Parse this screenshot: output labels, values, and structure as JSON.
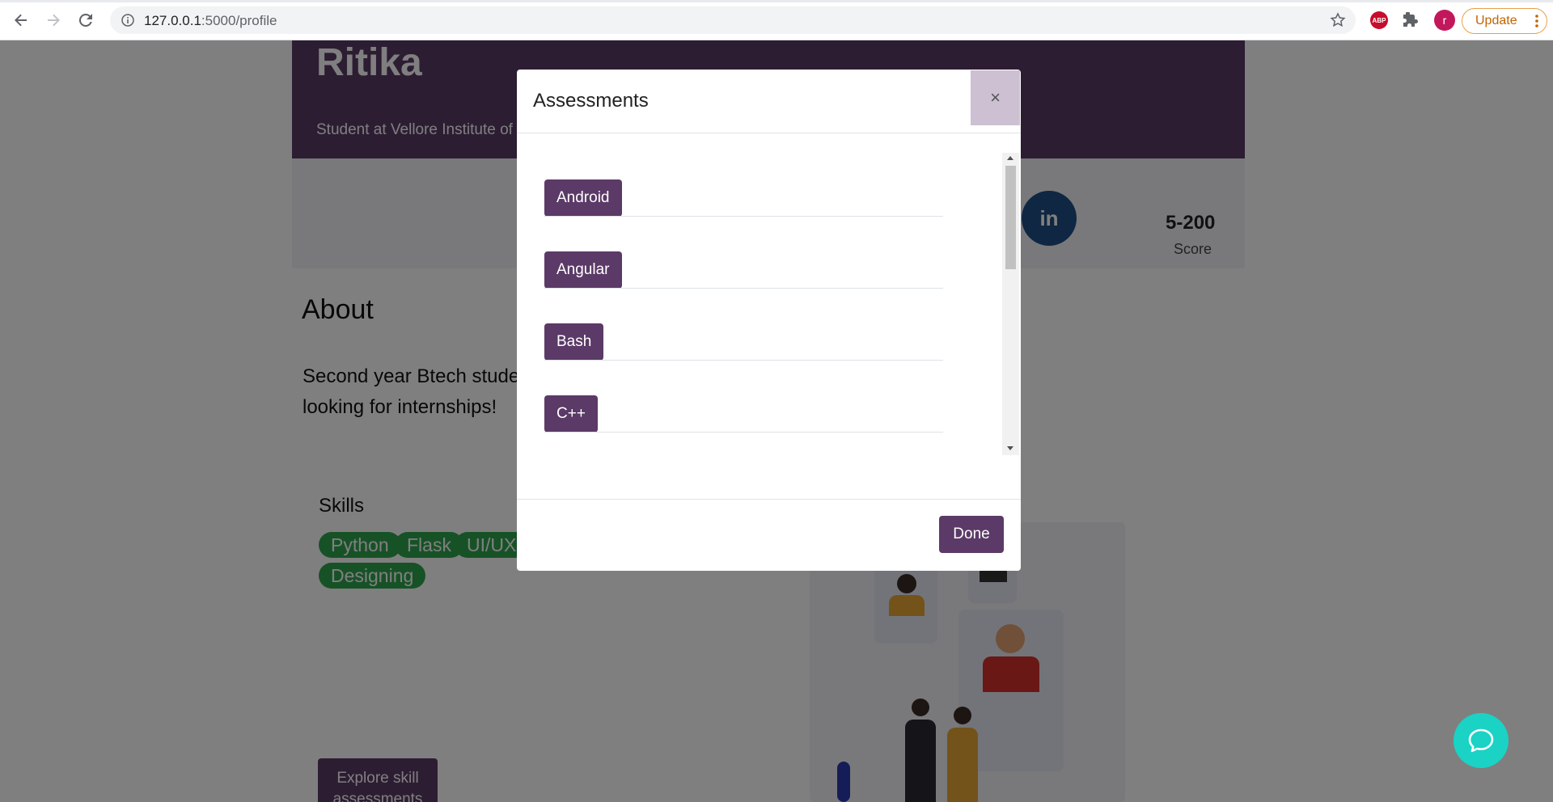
{
  "browser": {
    "url_host": "127.0.0.1",
    "url_port_path": ":5000/profile",
    "abp_label": "ABP",
    "avatar_letter": "r",
    "update_label": "Update"
  },
  "profile": {
    "name": "Ritika",
    "subtitle": "Student at Vellore Institute of Technology",
    "score_value": "5-200",
    "score_label": "Score",
    "linkedin_label": "in",
    "about_heading": "About",
    "about_text": "Second year Btech student looking for internships!",
    "skills_heading": "Skills",
    "skills": [
      "Python",
      "Flask",
      "UI/UX",
      "Designing"
    ],
    "explore_label": "Explore skill assessments"
  },
  "modal": {
    "title": "Assessments",
    "close_symbol": "×",
    "assessments": [
      "Android",
      "Angular",
      "Bash",
      "C++"
    ],
    "done_label": "Done"
  },
  "colors": {
    "primary": "#5b3a67",
    "skill_chip": "#2ea44f",
    "chat_bubble": "#1ad3c5",
    "linkedin": "#1f4f84"
  },
  "icons": {
    "back": "arrow-left-icon",
    "forward": "arrow-right-icon",
    "reload": "reload-icon",
    "info": "info-icon",
    "star": "star-icon",
    "extensions": "puzzle-icon",
    "menu": "kebab-menu-icon",
    "chat": "chat-bubble-icon"
  }
}
